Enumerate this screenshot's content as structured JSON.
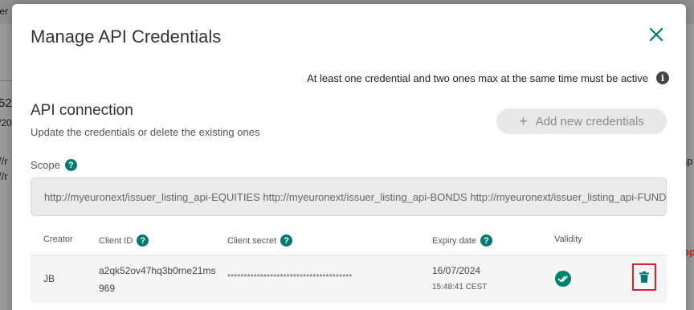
{
  "background": {
    "tab_text": "ter",
    "frag_a": "52",
    "frag_b": "/20",
    "frag_c": "//r",
    "frag_d": "//r",
    "frag_e": "ap",
    "frag_f": "op"
  },
  "modal": {
    "title": "Manage API Credentials",
    "close_icon": "close-icon",
    "notice": "At least one credential and two ones max at the same time must be active",
    "notice_icon": "i",
    "section_title": "API connection",
    "section_subtitle": "Update the credentials or delete the existing ones",
    "add_button_label": "Add new credentials",
    "add_button_icon": "+",
    "scope_label": "Scope",
    "help_glyph": "?",
    "scope_value": "http://myeuronext/issuer_listing_api-EQUITIES http://myeuronext/issuer_listing_api-BONDS http://myeuronext/issuer_listing_api-FUNDS"
  },
  "table": {
    "columns": {
      "creator": "Creator",
      "client_id": "Client ID",
      "client_secret": "Client secret",
      "expiry_date": "Expiry date",
      "validity": "Validity"
    },
    "rows": [
      {
        "creator": "JB",
        "client_id": "a2qk52ov47hq3b0rne21ms969",
        "client_secret": "**************************************",
        "expiry_date": "16/07/2024",
        "expiry_time": "15:48:41 CEST",
        "validity": "valid"
      }
    ]
  },
  "colors": {
    "accent": "#007a6e",
    "delete_highlight": "#d8232a",
    "valid": "#00806f"
  }
}
